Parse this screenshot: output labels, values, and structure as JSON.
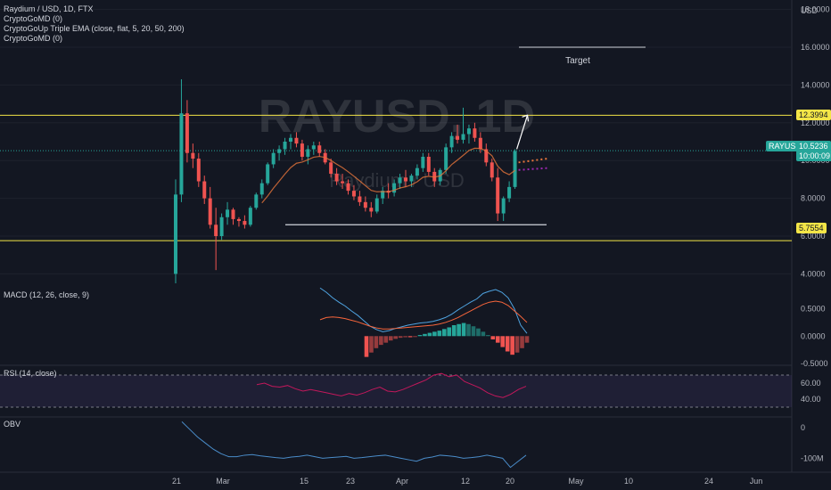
{
  "legend": {
    "title": "Raydium / USD, 1D, FTX",
    "indicators": [
      "CryptoGoMD (0)",
      "CryptoGoUp Triple EMA (close, flat, 5, 20, 50, 200)",
      "CryptoGoMD (0)"
    ]
  },
  "watermark": {
    "symbol": "RAYUSD, 1D",
    "name": "Raydium / USD"
  },
  "currency": "USD",
  "annotation_target": "Target",
  "price_axis": {
    "ticks": [
      "18.0000",
      "16.0000",
      "14.0000",
      "12.0000",
      "10.0000",
      "8.0000",
      "6.0000",
      "4.0000"
    ]
  },
  "price_tags": {
    "resistance": "12.3994",
    "support": "5.7554",
    "symbol": "RAYUSD",
    "last": "10.5236",
    "countdown": "10:00:09"
  },
  "macd": {
    "label": "MACD (12, 26, close, 9)",
    "ticks": [
      "0.5000",
      "0.0000",
      "-0.5000"
    ]
  },
  "rsi": {
    "label": "RSI (14, close)",
    "ticks": [
      "60.00",
      "40.00"
    ]
  },
  "obv": {
    "label": "OBV",
    "ticks": [
      "0",
      "-100M"
    ]
  },
  "time_axis": [
    "21",
    "Mar",
    "15",
    "23",
    "Apr",
    "12",
    "20",
    "May",
    "10",
    "24",
    "Jun"
  ],
  "colors": {
    "background": "#131722",
    "up": "#26a69a",
    "down": "#ef5350",
    "level_line": "#f3e547",
    "macd_line": "#4fa3e0",
    "signal_line": "#f7653b",
    "rsi_line": "#c2185b",
    "obv_line": "#4a8cc9",
    "ema_orange": "#e8763b",
    "ema_purple": "#9c27b0"
  },
  "chart_data": [
    {
      "type": "candlestick",
      "title": "Raydium / USD, 1D, FTX",
      "x_axis": "date (Feb 21 – Apr 21)",
      "ylim": [
        3.5,
        18.5
      ],
      "levels": [
        12.3994,
        5.7554
      ],
      "support_line": 6.6,
      "target_line": 16.0,
      "last_price": 10.5236,
      "ohlc": [
        [
          4.0,
          9.0,
          3.5,
          8.2
        ],
        [
          8.2,
          14.3,
          7.8,
          12.5
        ],
        [
          12.5,
          13.2,
          9.9,
          10.4
        ],
        [
          10.4,
          10.9,
          9.6,
          10.1
        ],
        [
          10.1,
          10.4,
          8.6,
          8.9
        ],
        [
          8.9,
          9.2,
          7.7,
          8.0
        ],
        [
          8.0,
          8.6,
          6.4,
          6.6
        ],
        [
          6.6,
          7.5,
          4.2,
          6.0
        ],
        [
          6.0,
          7.2,
          5.8,
          7.0
        ],
        [
          7.0,
          7.8,
          6.6,
          7.4
        ],
        [
          7.4,
          7.5,
          6.6,
          6.9
        ],
        [
          6.9,
          7.0,
          6.5,
          6.8
        ],
        [
          6.8,
          7.1,
          6.4,
          6.6
        ],
        [
          6.6,
          7.6,
          6.5,
          7.5
        ],
        [
          7.5,
          8.3,
          7.4,
          8.2
        ],
        [
          8.2,
          9.0,
          8.0,
          8.8
        ],
        [
          8.8,
          9.9,
          8.7,
          9.8
        ],
        [
          9.8,
          10.6,
          9.6,
          10.4
        ],
        [
          10.4,
          10.8,
          10.0,
          10.6
        ],
        [
          10.6,
          11.2,
          10.3,
          11.0
        ],
        [
          11.0,
          11.4,
          10.6,
          11.2
        ],
        [
          11.2,
          11.5,
          10.7,
          10.9
        ],
        [
          10.9,
          11.1,
          10.0,
          10.2
        ],
        [
          10.2,
          10.8,
          9.8,
          10.6
        ],
        [
          10.6,
          11.0,
          10.3,
          10.8
        ],
        [
          10.8,
          11.0,
          10.2,
          10.4
        ],
        [
          10.4,
          10.6,
          9.8,
          9.9
        ],
        [
          9.9,
          10.1,
          9.1,
          9.3
        ],
        [
          9.3,
          9.6,
          8.7,
          8.9
        ],
        [
          8.9,
          9.3,
          8.5,
          8.8
        ],
        [
          8.8,
          9.0,
          8.2,
          8.4
        ],
        [
          8.4,
          8.7,
          7.9,
          8.1
        ],
        [
          8.1,
          8.4,
          7.6,
          7.8
        ],
        [
          7.8,
          8.1,
          7.3,
          7.5
        ],
        [
          7.5,
          7.8,
          7.0,
          7.3
        ],
        [
          7.3,
          8.2,
          7.2,
          8.0
        ],
        [
          8.0,
          8.6,
          7.7,
          8.4
        ],
        [
          8.4,
          8.8,
          8.0,
          8.3
        ],
        [
          8.3,
          9.0,
          8.1,
          8.8
        ],
        [
          8.8,
          9.3,
          8.5,
          9.1
        ],
        [
          9.1,
          9.5,
          8.6,
          8.9
        ],
        [
          8.9,
          9.3,
          8.6,
          9.2
        ],
        [
          9.2,
          9.8,
          9.0,
          9.6
        ],
        [
          9.6,
          10.4,
          9.4,
          10.2
        ],
        [
          10.2,
          10.4,
          9.2,
          9.4
        ],
        [
          9.4,
          9.6,
          8.6,
          8.9
        ],
        [
          8.9,
          9.6,
          8.7,
          9.5
        ],
        [
          9.5,
          10.9,
          9.3,
          10.7
        ],
        [
          10.7,
          11.5,
          10.4,
          11.3
        ],
        [
          11.3,
          11.9,
          10.9,
          11.1
        ],
        [
          11.1,
          12.8,
          10.9,
          11.4
        ],
        [
          11.4,
          11.9,
          10.9,
          11.7
        ],
        [
          11.7,
          12.0,
          11.0,
          11.2
        ],
        [
          11.2,
          11.5,
          10.4,
          10.6
        ],
        [
          10.6,
          10.9,
          9.7,
          9.9
        ],
        [
          9.9,
          10.1,
          8.9,
          9.1
        ],
        [
          9.1,
          9.6,
          6.8,
          7.2
        ],
        [
          7.2,
          8.1,
          6.8,
          8.0
        ],
        [
          8.0,
          8.9,
          7.8,
          8.6
        ],
        [
          8.6,
          10.6,
          8.5,
          10.5
        ]
      ]
    },
    {
      "type": "line",
      "title": "MACD (12, 26, close, 9)",
      "ylim": [
        -0.5,
        0.9
      ],
      "macd": [
        0.88,
        0.8,
        0.7,
        0.62,
        0.55,
        0.46,
        0.38,
        0.28,
        0.18,
        0.12,
        0.08,
        0.1,
        0.14,
        0.17,
        0.2,
        0.22,
        0.24,
        0.25,
        0.27,
        0.3,
        0.34,
        0.4,
        0.48,
        0.55,
        0.62,
        0.68,
        0.78,
        0.82,
        0.85,
        0.8,
        0.7,
        0.5,
        0.2,
        0.05
      ],
      "signal": [
        0.3,
        0.34,
        0.35,
        0.34,
        0.32,
        0.29,
        0.26,
        0.22,
        0.18,
        0.15,
        0.13,
        0.13,
        0.14,
        0.15,
        0.16,
        0.17,
        0.18,
        0.19,
        0.2,
        0.22,
        0.25,
        0.29,
        0.34,
        0.4,
        0.46,
        0.52,
        0.58,
        0.62,
        0.64,
        0.62,
        0.56,
        0.46,
        0.36,
        0.25
      ],
      "histogram": [
        -0.38,
        -0.3,
        -0.22,
        -0.16,
        -0.12,
        -0.08,
        -0.05,
        -0.03,
        -0.02,
        -0.02,
        -0.01,
        0.02,
        0.04,
        0.06,
        0.08,
        0.1,
        0.13,
        0.16,
        0.2,
        0.22,
        0.24,
        0.22,
        0.18,
        0.14,
        0.08,
        0.02,
        -0.06,
        -0.12,
        -0.2,
        -0.28,
        -0.34,
        -0.3,
        -0.22,
        -0.12
      ]
    },
    {
      "type": "line",
      "title": "RSI (14, close)",
      "ylim": [
        20,
        80
      ],
      "values": [
        58,
        60,
        56,
        55,
        57,
        53,
        50,
        52,
        50,
        48,
        46,
        44,
        47,
        45,
        48,
        52,
        55,
        50,
        49,
        52,
        56,
        60,
        64,
        70,
        72,
        68,
        70,
        62,
        58,
        54,
        48,
        44,
        42,
        46,
        52,
        56
      ]
    },
    {
      "type": "line",
      "title": "OBV",
      "ylim": [
        -140,
        30
      ],
      "values": [
        20,
        -5,
        -30,
        -50,
        -70,
        -85,
        -95,
        -95,
        -90,
        -88,
        -92,
        -95,
        -98,
        -100,
        -96,
        -94,
        -90,
        -95,
        -100,
        -98,
        -96,
        -94,
        -100,
        -98,
        -95,
        -92,
        -90,
        -95,
        -100,
        -105,
        -110,
        -100,
        -96,
        -90,
        -92,
        -95,
        -100,
        -98,
        -95,
        -90,
        -95,
        -100,
        -130,
        -110,
        -90
      ]
    }
  ]
}
